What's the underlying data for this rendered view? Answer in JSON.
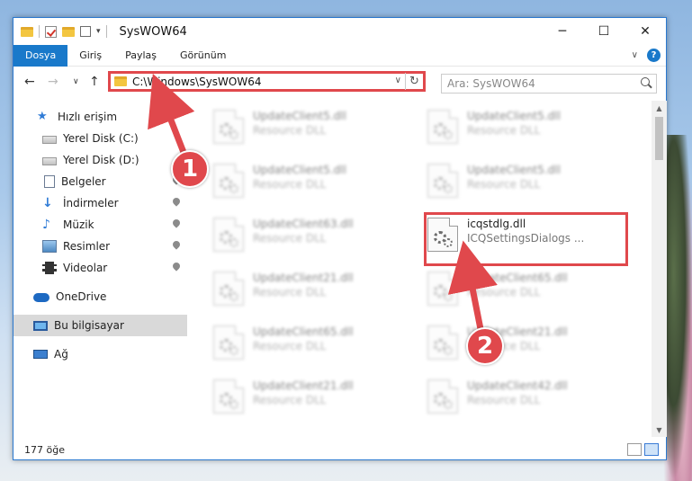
{
  "window": {
    "title": "SysWOW64"
  },
  "window_controls": {
    "minimize": "─",
    "maximize": "☐",
    "close": "✕"
  },
  "ribbon": {
    "tabs": [
      "Dosya",
      "Giriş",
      "Paylaş",
      "Görünüm"
    ],
    "help": "?"
  },
  "address": {
    "path": "C:\\Windows\\SysWOW64"
  },
  "search": {
    "placeholder": "Ara: SysWOW64"
  },
  "sidebar": {
    "items": [
      {
        "label": "Hızlı erişim",
        "icon": "star-icon"
      },
      {
        "label": "Yerel Disk (C:)",
        "icon": "drive-icon"
      },
      {
        "label": "Yerel Disk (D:)",
        "icon": "drive-icon"
      },
      {
        "label": "Belgeler",
        "icon": "documents-icon"
      },
      {
        "label": "İndirmeler",
        "icon": "download-icon"
      },
      {
        "label": "Müzik",
        "icon": "music-icon"
      },
      {
        "label": "Resimler",
        "icon": "pictures-icon"
      },
      {
        "label": "Videolar",
        "icon": "video-icon"
      },
      {
        "label": "OneDrive",
        "icon": "cloud-icon"
      },
      {
        "label": "Bu bilgisayar",
        "icon": "computer-icon"
      },
      {
        "label": "Ağ",
        "icon": "network-icon"
      }
    ]
  },
  "files": [
    {
      "name": "UpdateClient5.dll",
      "desc": "Resource DLL"
    },
    {
      "name": "UpdateClient5.dll",
      "desc": "Resource DLL"
    },
    {
      "name": "UpdateClient5.dll",
      "desc": "Resource DLL"
    },
    {
      "name": "UpdateClient5.dll",
      "desc": "Resource DLL"
    },
    {
      "name": "UpdateClient63.dll",
      "desc": "Resource DLL"
    },
    {
      "name": "icqstdlg.dll",
      "desc": "ICQSettingsDialogs ..."
    },
    {
      "name": "UpdateClient21.dll",
      "desc": "Resource DLL"
    },
    {
      "name": "UpdateClient65.dll",
      "desc": "Resource DLL"
    },
    {
      "name": "UpdateClient65.dll",
      "desc": "Resource DLL"
    },
    {
      "name": "UpdateClient21.dll",
      "desc": "Resource DLL"
    },
    {
      "name": "UpdateClient21.dll",
      "desc": "Resource DLL"
    },
    {
      "name": "UpdateClient42.dll",
      "desc": "Resource DLL"
    }
  ],
  "status": {
    "count": "177 öğe"
  },
  "callouts": {
    "one": "1",
    "two": "2"
  },
  "colors": {
    "accent": "#1979ca",
    "highlight": "#e0484c"
  }
}
